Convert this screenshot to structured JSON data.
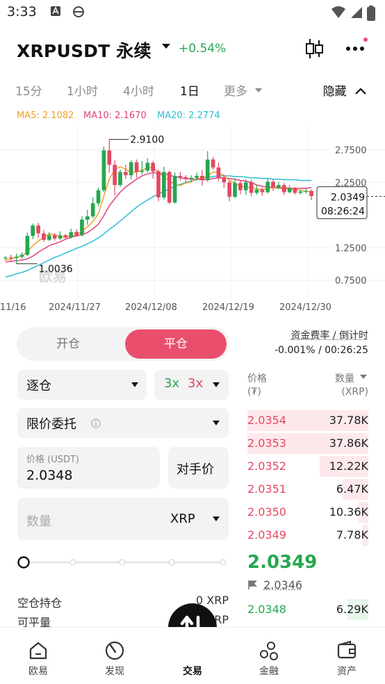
{
  "status": {
    "time": "3:33"
  },
  "header": {
    "symbol": "XRPUSDT 永续",
    "change": "+0.54%",
    "colors": {
      "up": "#25a750",
      "down": "#e24864",
      "accent": "#ea4e6d"
    }
  },
  "intervals": {
    "items": [
      "15分",
      "1小时",
      "4小时",
      "1日",
      "更多"
    ],
    "active": "1日",
    "hide_label": "隐藏"
  },
  "chart_data": {
    "type": "candlestick",
    "ma_legend": [
      "MA5: 2.1082",
      "MA10: 2.1670",
      "MA20: 2.2774"
    ],
    "ma_colors": [
      "#f0a02a",
      "#e0407a",
      "#2fbcd4"
    ],
    "y_ticks": [
      "2.7500",
      "2.2500",
      "1.2500",
      "0.7500"
    ],
    "x_ticks": [
      "11/16",
      "2024/11/27",
      "2024/12/08",
      "2024/12/19",
      "2024/12/30"
    ],
    "high_label": "2.9100",
    "low_label": "1.0036",
    "current_price": "2.0349",
    "countdown": "08:26:24",
    "watermark": "欧易",
    "ylim": [
      0.55,
      3.0
    ],
    "candles": [
      [
        1.09,
        1.1,
        1.05,
        1.12
      ],
      [
        1.1,
        1.09,
        1.04,
        1.14
      ],
      [
        1.09,
        1.11,
        1.0,
        1.16
      ],
      [
        1.11,
        1.14,
        1.08,
        1.18
      ],
      [
        1.14,
        1.43,
        1.12,
        1.48
      ],
      [
        1.43,
        1.59,
        1.38,
        1.62
      ],
      [
        1.59,
        1.47,
        1.4,
        1.63
      ],
      [
        1.47,
        1.37,
        1.34,
        1.52
      ],
      [
        1.37,
        1.44,
        1.35,
        1.49
      ],
      [
        1.44,
        1.39,
        1.36,
        1.47
      ],
      [
        1.39,
        1.44,
        1.37,
        1.5
      ],
      [
        1.44,
        1.41,
        1.38,
        1.46
      ],
      [
        1.41,
        1.49,
        1.39,
        1.54
      ],
      [
        1.49,
        1.44,
        1.42,
        1.53
      ],
      [
        1.44,
        1.68,
        1.42,
        1.73
      ],
      [
        1.68,
        1.73,
        1.6,
        1.83
      ],
      [
        1.73,
        1.93,
        1.7,
        2.02
      ],
      [
        1.93,
        2.13,
        1.88,
        2.17
      ],
      [
        2.13,
        2.74,
        2.1,
        2.8
      ],
      [
        2.74,
        2.52,
        2.4,
        2.91
      ],
      [
        2.52,
        2.21,
        2.05,
        2.59
      ],
      [
        2.21,
        2.41,
        2.18,
        2.45
      ],
      [
        2.41,
        2.36,
        2.3,
        2.52
      ],
      [
        2.36,
        2.56,
        2.3,
        2.59
      ],
      [
        2.56,
        2.41,
        2.32,
        2.6
      ],
      [
        2.41,
        2.43,
        2.37,
        2.58
      ],
      [
        2.43,
        2.55,
        2.4,
        2.62
      ],
      [
        2.55,
        2.42,
        2.31,
        2.58
      ],
      [
        2.42,
        2.02,
        1.96,
        2.45
      ],
      [
        2.02,
        2.41,
        1.99,
        2.49
      ],
      [
        2.41,
        1.94,
        1.92,
        2.43
      ],
      [
        1.94,
        2.35,
        1.93,
        2.4
      ],
      [
        2.35,
        2.33,
        2.28,
        2.41
      ],
      [
        2.33,
        2.3,
        2.25,
        2.36
      ],
      [
        2.3,
        2.32,
        2.25,
        2.36
      ],
      [
        2.32,
        2.35,
        2.29,
        2.4
      ],
      [
        2.35,
        2.29,
        2.2,
        2.44
      ],
      [
        2.29,
        2.6,
        2.26,
        2.73
      ],
      [
        2.6,
        2.48,
        2.44,
        2.64
      ],
      [
        2.48,
        2.32,
        2.27,
        2.55
      ],
      [
        2.32,
        2.25,
        2.17,
        2.37
      ],
      [
        2.25,
        2.03,
        1.96,
        2.28
      ],
      [
        2.03,
        2.24,
        2.01,
        2.31
      ],
      [
        2.24,
        2.13,
        2.07,
        2.27
      ],
      [
        2.13,
        2.25,
        2.06,
        2.3
      ],
      [
        2.25,
        2.09,
        2.04,
        2.29
      ],
      [
        2.09,
        2.14,
        2.06,
        2.21
      ],
      [
        2.14,
        2.1,
        2.05,
        2.17
      ],
      [
        2.1,
        2.26,
        2.08,
        2.3
      ],
      [
        2.26,
        2.17,
        2.12,
        2.29
      ],
      [
        2.17,
        2.21,
        2.15,
        2.26
      ],
      [
        2.21,
        2.1,
        2.06,
        2.24
      ],
      [
        2.1,
        2.16,
        2.08,
        2.21
      ],
      [
        2.16,
        2.09,
        2.06,
        2.18
      ],
      [
        2.09,
        2.11,
        2.06,
        2.14
      ],
      [
        2.11,
        2.12,
        2.08,
        2.16
      ],
      [
        2.12,
        2.04,
        1.98,
        2.14
      ]
    ],
    "ma5": [
      1.06,
      1.08,
      1.1,
      1.12,
      1.19,
      1.28,
      1.35,
      1.41,
      1.46,
      1.45,
      1.42,
      1.41,
      1.43,
      1.45,
      1.5,
      1.57,
      1.65,
      1.77,
      2.04,
      2.3,
      2.45,
      2.49,
      2.45,
      2.4,
      2.41,
      2.44,
      2.47,
      2.48,
      2.4,
      2.34,
      2.27,
      2.22,
      2.2,
      2.24,
      2.26,
      2.31,
      2.31,
      2.35,
      2.41,
      2.4,
      2.35,
      2.28,
      2.24,
      2.19,
      2.18,
      2.17,
      2.15,
      2.14,
      2.16,
      2.17,
      2.16,
      2.15,
      2.15,
      2.14,
      2.13,
      2.11,
      2.11
    ],
    "ma10": [
      1.03,
      1.04,
      1.05,
      1.06,
      1.08,
      1.12,
      1.18,
      1.23,
      1.28,
      1.31,
      1.34,
      1.38,
      1.41,
      1.43,
      1.45,
      1.48,
      1.54,
      1.61,
      1.74,
      1.89,
      2.0,
      2.1,
      2.18,
      2.24,
      2.3,
      2.35,
      2.38,
      2.4,
      2.39,
      2.38,
      2.36,
      2.34,
      2.32,
      2.31,
      2.3,
      2.3,
      2.29,
      2.29,
      2.31,
      2.32,
      2.32,
      2.31,
      2.3,
      2.28,
      2.27,
      2.25,
      2.21,
      2.19,
      2.18,
      2.18,
      2.17,
      2.17,
      2.16,
      2.16,
      2.16,
      2.16,
      2.17
    ],
    "ma20": [
      0.8,
      0.82,
      0.85,
      0.87,
      0.9,
      0.94,
      0.98,
      1.02,
      1.06,
      1.1,
      1.13,
      1.17,
      1.2,
      1.24,
      1.27,
      1.31,
      1.35,
      1.4,
      1.46,
      1.53,
      1.59,
      1.66,
      1.73,
      1.8,
      1.87,
      1.93,
      1.98,
      2.03,
      2.07,
      2.11,
      2.15,
      2.19,
      2.22,
      2.25,
      2.27,
      2.29,
      2.31,
      2.33,
      2.34,
      2.35,
      2.35,
      2.35,
      2.34,
      2.34,
      2.33,
      2.32,
      2.32,
      2.31,
      2.31,
      2.3,
      2.3,
      2.29,
      2.29,
      2.29,
      2.28,
      2.28,
      2.28
    ]
  },
  "trade_form": {
    "tab_open": "开仓",
    "tab_close": "平仓",
    "funding_label": "资金费率 / 倒计时",
    "funding_value": "-0.001% / 00:26:25",
    "margin_mode": "逐仓",
    "leverage_long": "3x",
    "leverage_short": "3x",
    "order_type": "限价委托",
    "price_label": "价格 (USDT)",
    "price_value": "2.0348",
    "counterparty_button": "对手价",
    "quantity_placeholder": "数量",
    "quantity_unit": "XRP",
    "short_position_label": "空仓持仓",
    "short_position_value": "0 XRP",
    "closable_label": "可平量",
    "closable_value": "0 XRP"
  },
  "orderbook": {
    "price_header": "价格",
    "price_unit": "(₮)",
    "qty_header": "数量",
    "qty_unit": "(XRP)",
    "asks": [
      {
        "price": "2.0354",
        "qty": "37.78K",
        "depth": 1.0
      },
      {
        "price": "2.0353",
        "qty": "37.86K",
        "depth": 1.0
      },
      {
        "price": "2.0352",
        "qty": "12.22K",
        "depth": 0.4
      },
      {
        "price": "2.0351",
        "qty": "6.47K",
        "depth": 0.21
      },
      {
        "price": "2.0350",
        "qty": "10.36K",
        "depth": 0.08
      },
      {
        "price": "2.0349",
        "qty": "7.78K",
        "depth": 0.05
      }
    ],
    "last_price": "2.0349",
    "mark_price": "2.0346",
    "bids": [
      {
        "price": "2.0348",
        "qty": "6.29K",
        "depth": 0.17
      }
    ]
  },
  "bottom_nav": {
    "items": [
      "欧易",
      "发现",
      "交易",
      "金融",
      "资产"
    ]
  }
}
